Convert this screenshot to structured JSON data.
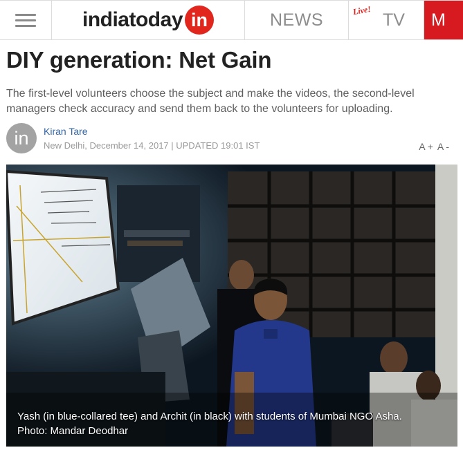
{
  "header": {
    "logo_text": "indiatoday",
    "logo_badge": "in",
    "nav": {
      "news": "NEWS",
      "live": "Live!",
      "tv": "TV",
      "more": "M"
    }
  },
  "article": {
    "headline": "DIY generation: Net Gain",
    "summary": "The first-level volunteers choose the subject and make the videos, the second-level managers check accuracy and send them back to the volunteers for uploading.",
    "avatar_text": "in",
    "author": "Kiran Tare",
    "dateline": "New Delhi, December 14, 2017 | UPDATED 19:01 IST",
    "font_increase": "A +",
    "font_decrease": "A -"
  },
  "photo": {
    "caption_line1": "Yash (in blue-collared tee) and Archit (in black) with students of Mumbai NGO Asha.",
    "caption_line2": "Photo: Mandar Deodhar"
  },
  "colors": {
    "brand_red": "#d71920",
    "author_blue": "#3366aa"
  },
  "icons": {
    "menu": "hamburger-icon"
  }
}
